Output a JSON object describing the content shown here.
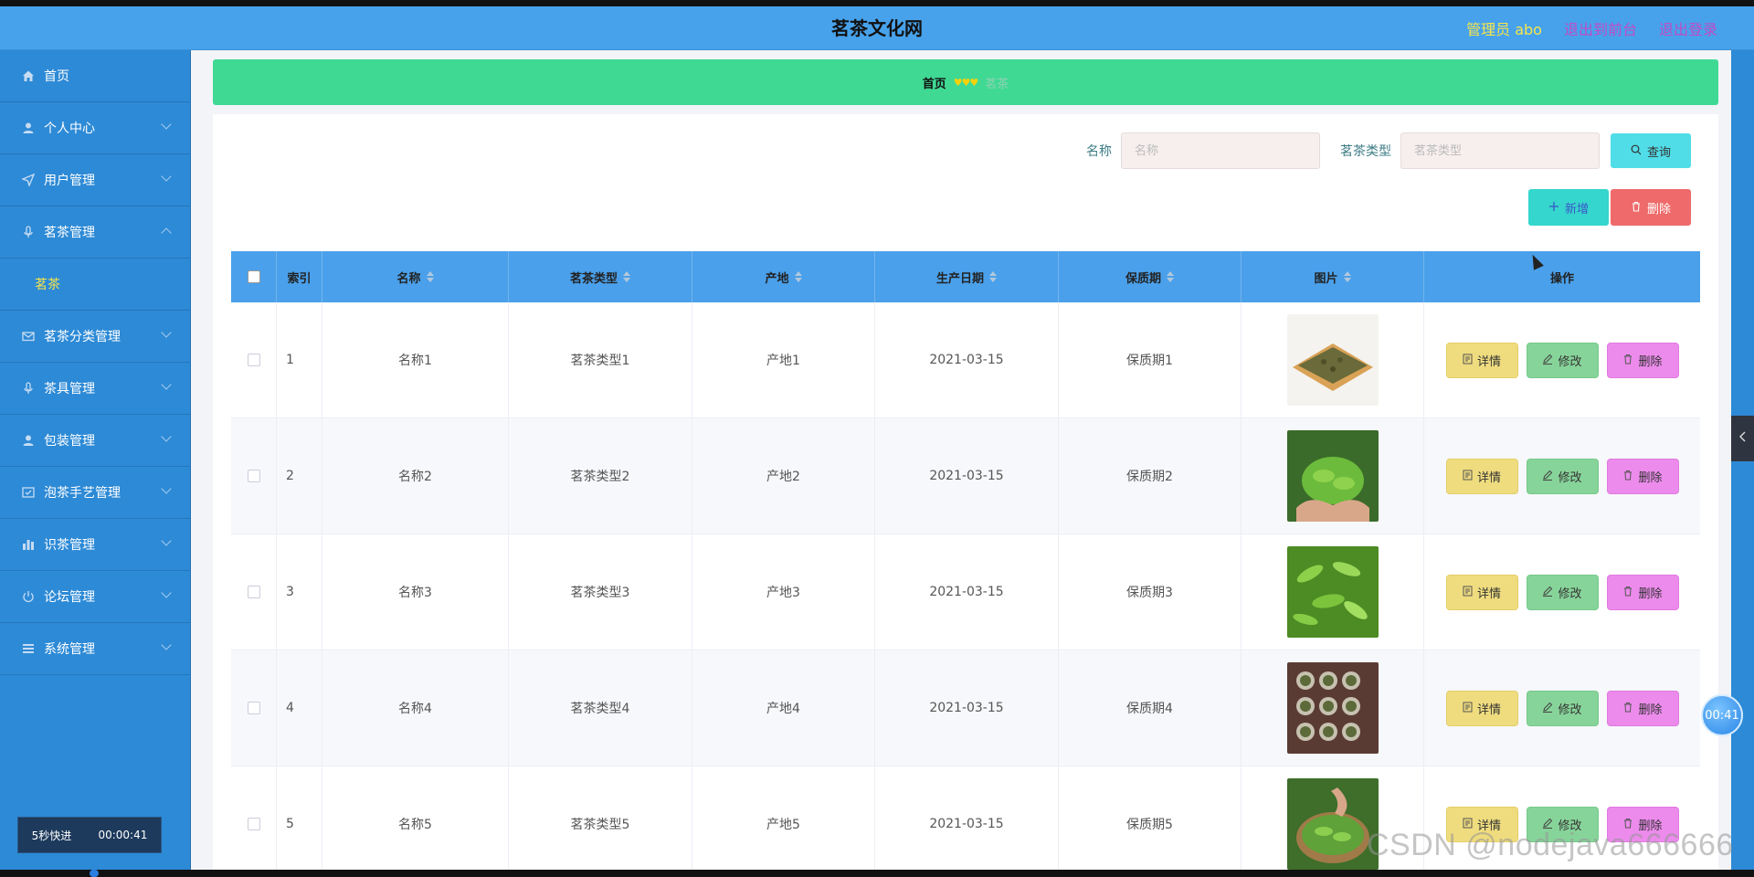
{
  "header": {
    "title": "茗茶文化网",
    "admin": "管理员 abo",
    "back_front": "退出到前台",
    "logout": "退出登录"
  },
  "sidebar": {
    "items": [
      {
        "label": "首页",
        "icon": "home-icon",
        "expandable": false
      },
      {
        "label": "个人中心",
        "icon": "user-icon",
        "expandable": true
      },
      {
        "label": "用户管理",
        "icon": "send-icon",
        "expandable": true
      },
      {
        "label": "茗茶管理",
        "icon": "mic-icon",
        "expandable": true,
        "expanded": true,
        "sub": "茗茶"
      },
      {
        "label": "茗茶分类管理",
        "icon": "mail-icon",
        "expandable": true
      },
      {
        "label": "茶具管理",
        "icon": "mic-icon",
        "expandable": true
      },
      {
        "label": "包装管理",
        "icon": "user-icon",
        "expandable": true
      },
      {
        "label": "泡茶手艺管理",
        "icon": "check-square-icon",
        "expandable": true
      },
      {
        "label": "识茶管理",
        "icon": "bar-chart-icon",
        "expandable": true
      },
      {
        "label": "论坛管理",
        "icon": "power-icon",
        "expandable": true
      },
      {
        "label": "系统管理",
        "icon": "list-icon",
        "expandable": true
      }
    ],
    "fast_label": "5秒快进",
    "fast_time": "00:00:41"
  },
  "breadcrumb": {
    "home": "首页",
    "hearts": "♥♥♥",
    "current": "茗茶"
  },
  "search": {
    "name_label": "名称",
    "name_placeholder": "名称",
    "type_label": "茗茶类型",
    "type_placeholder": "茗茶类型",
    "query_label": "查询"
  },
  "actions": {
    "add_label": "新增",
    "delete_label": "删除"
  },
  "table": {
    "headers": [
      "索引",
      "名称",
      "茗茶类型",
      "产地",
      "生产日期",
      "保质期",
      "图片",
      "操作"
    ],
    "rows": [
      {
        "index": "1",
        "name": "名称1",
        "type": "茗茶类型1",
        "origin": "产地1",
        "date": "2021-03-15",
        "shelf": "保质期1"
      },
      {
        "index": "2",
        "name": "名称2",
        "type": "茗茶类型2",
        "origin": "产地2",
        "date": "2021-03-15",
        "shelf": "保质期2"
      },
      {
        "index": "3",
        "name": "名称3",
        "type": "茗茶类型3",
        "origin": "产地3",
        "date": "2021-03-15",
        "shelf": "保质期3"
      },
      {
        "index": "4",
        "name": "名称4",
        "type": "茗茶类型4",
        "origin": "产地4",
        "date": "2021-03-15",
        "shelf": "保质期4"
      },
      {
        "index": "5",
        "name": "名称5",
        "type": "茗茶类型5",
        "origin": "产地5",
        "date": "2021-03-15",
        "shelf": "保质期5"
      }
    ],
    "op_detail": "详情",
    "op_edit": "修改",
    "op_delete": "删除"
  },
  "overlay": {
    "timer": "00:41",
    "watermark": "CSDN @nodejava666666"
  },
  "colors": {
    "header_bg": "#47a2eb",
    "sidebar_bg": "#2d8ad6",
    "breadcrumb_bg": "#3fd994",
    "table_header_bg": "#4aa0ea",
    "accent_yellow": "#f7e44b"
  }
}
